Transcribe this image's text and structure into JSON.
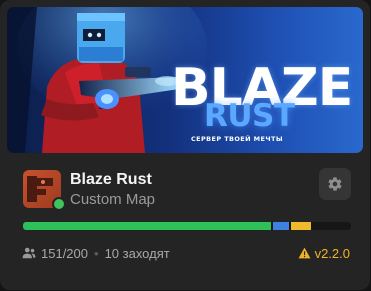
{
  "banner": {
    "brand_line1": "BLAZE",
    "brand_line2": "RUST",
    "slogan": "СЕРВЕР ТВОЕЙ МЕЧТЫ"
  },
  "server": {
    "name": "Blaze Rust",
    "map": "Custom Map",
    "status": "online"
  },
  "capacity": {
    "online_fraction": 0.755,
    "joining_fraction": 0.05,
    "queue_fraction": 0.06
  },
  "footer": {
    "players": "151/200",
    "joining": "10 заходят",
    "version": "v2.2.0"
  },
  "colors": {
    "online": "#2ec15a",
    "joining": "#3d82e0",
    "queue": "#f0bb2a",
    "warning": "#f2b427"
  }
}
